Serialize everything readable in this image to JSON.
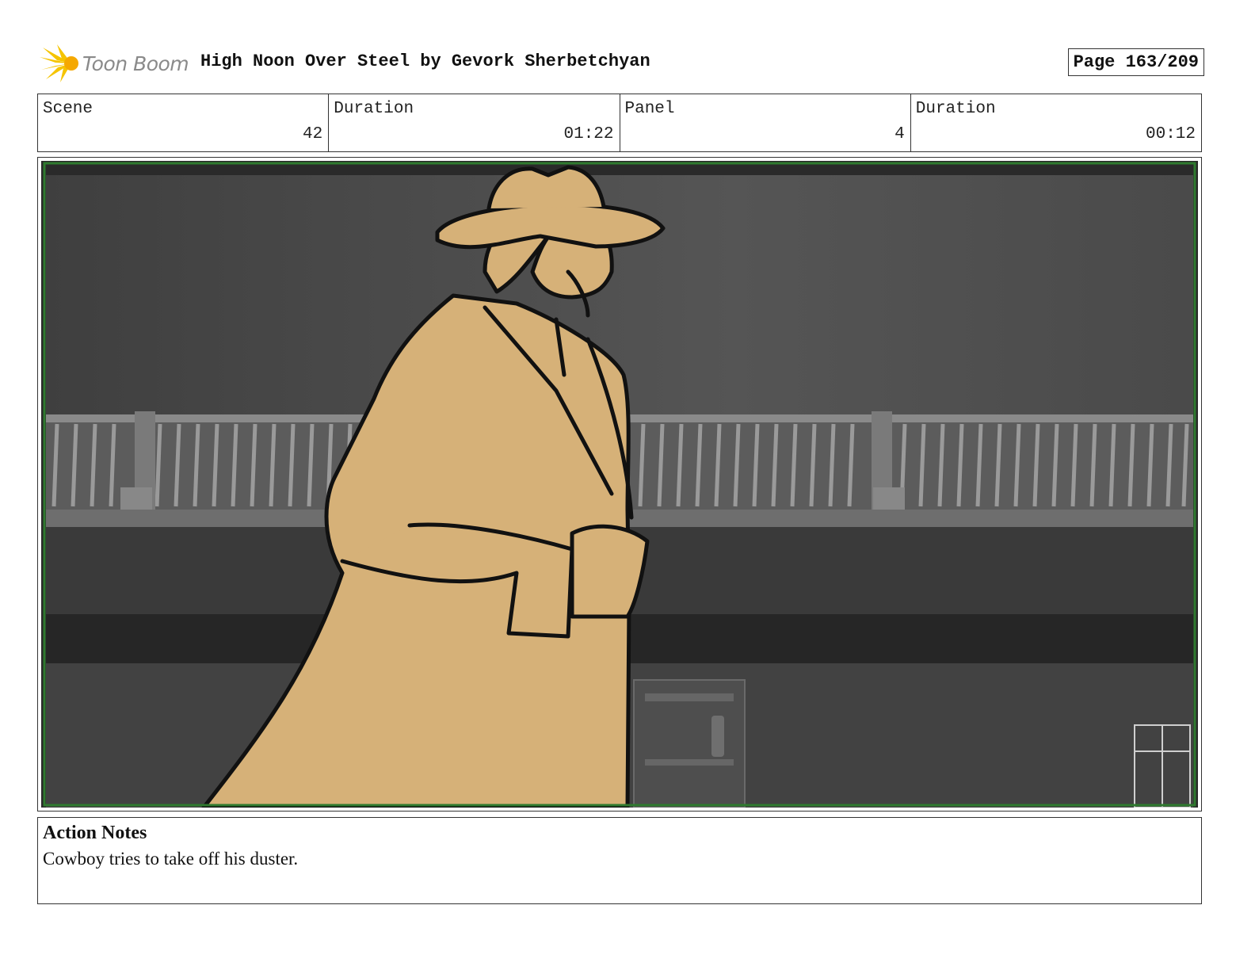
{
  "header": {
    "logo_text": "Toon Boom",
    "title": "High Noon Over Steel by Gevork Sherbetchyan",
    "page": "Page 163/209"
  },
  "info": [
    {
      "label": "Scene",
      "value": "42"
    },
    {
      "label": "Duration",
      "value": "01:22"
    },
    {
      "label": "Panel",
      "value": "4"
    },
    {
      "label": "Duration",
      "value": "00:12"
    }
  ],
  "notes": {
    "title": "Action Notes",
    "text": "Cowboy tries to take off his duster."
  },
  "colors": {
    "coat": "#d6b178",
    "frame_green": "#2f7a2f",
    "logo_yellow": "#f5c400"
  }
}
